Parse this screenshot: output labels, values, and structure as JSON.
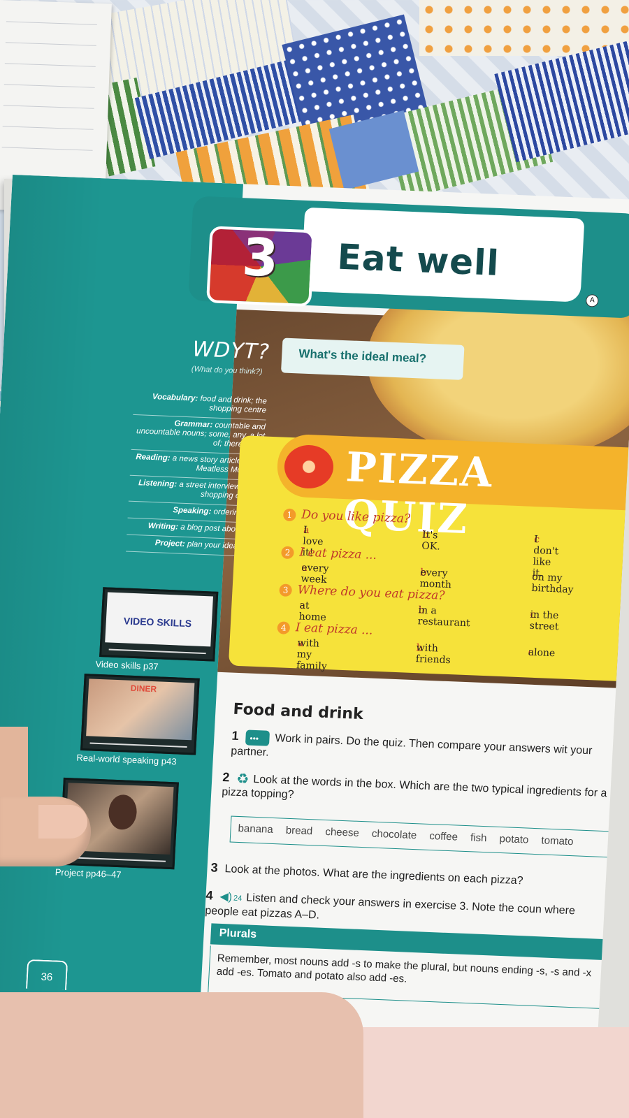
{
  "unit": {
    "number": "3",
    "title": "Eat well",
    "badge": "A"
  },
  "wdyt": {
    "title": "WDYT?",
    "subtitle": "(What do you think?)",
    "question": "What's the ideal meal?"
  },
  "syllabus": [
    {
      "label": "Vocabulary:",
      "text": "food and drink; the shopping centre"
    },
    {
      "label": "Grammar:",
      "text": "countable and uncountable nouns; some, any, a lot of; there is/are"
    },
    {
      "label": "Reading:",
      "text": "a news story article about Meatless Mondays"
    },
    {
      "label": "Listening:",
      "text": "a street interview about shopping centres"
    },
    {
      "label": "Speaking:",
      "text": "ordering food"
    },
    {
      "label": "Writing:",
      "text": "a blog post about food"
    },
    {
      "label": "Project:",
      "text": "plan your ideal meal"
    }
  ],
  "videos": [
    {
      "logo": "VIDEO SKILLS",
      "caption": "Video skills p37"
    },
    {
      "sign": "DINER",
      "caption": "Real-world speaking p43"
    },
    {
      "caption": "Project pp46–47"
    }
  ],
  "page_number": "36",
  "quiz": {
    "title": "PIZZA QUIZ",
    "questions": [
      {
        "num": "1",
        "text": "Do you like pizza?",
        "a": "I love it!",
        "b": "It's OK.",
        "c": "I don't like it."
      },
      {
        "num": "2",
        "text": "I eat pizza ...",
        "a": "every week",
        "b": "every month",
        "c": "on my birthday"
      },
      {
        "num": "3",
        "text": "Where do you eat pizza?",
        "a": "at home",
        "b": "in a restaurant",
        "c": "in the street"
      },
      {
        "num": "4",
        "text": "I eat pizza ...",
        "a": "with my family",
        "b": "with friends",
        "c": "alone"
      }
    ]
  },
  "section": {
    "title": "Food and drink",
    "ex1": {
      "num": "1",
      "text": "Work in pairs. Do the quiz. Then compare your answers wit your partner."
    },
    "ex2": {
      "num": "2",
      "text": "Look at the words in the box. Which are the two typical ingredients for a pizza topping?"
    },
    "words": [
      "banana",
      "bread",
      "cheese",
      "chocolate",
      "coffee",
      "fish",
      "potato",
      "tomato"
    ],
    "ex3": {
      "num": "3",
      "text": "Look at the photos. What are the ingredients on each pizza?"
    },
    "ex4": {
      "num": "4",
      "track": "24",
      "text": "Listen and check your answers in exercise 3. Note the coun where people eat pizzas A–D."
    },
    "plurals": {
      "title": "Plurals",
      "text": "Remember, most nouns add -s to make the plural, but nouns ending -s, -s and -x add -es. Tomato and potato also add -es."
    }
  },
  "colors": {
    "teal": "#1d9691",
    "quiz_yellow": "#f6e23a",
    "quiz_orange": "#f4b32b",
    "title_dark": "#144a4d"
  }
}
